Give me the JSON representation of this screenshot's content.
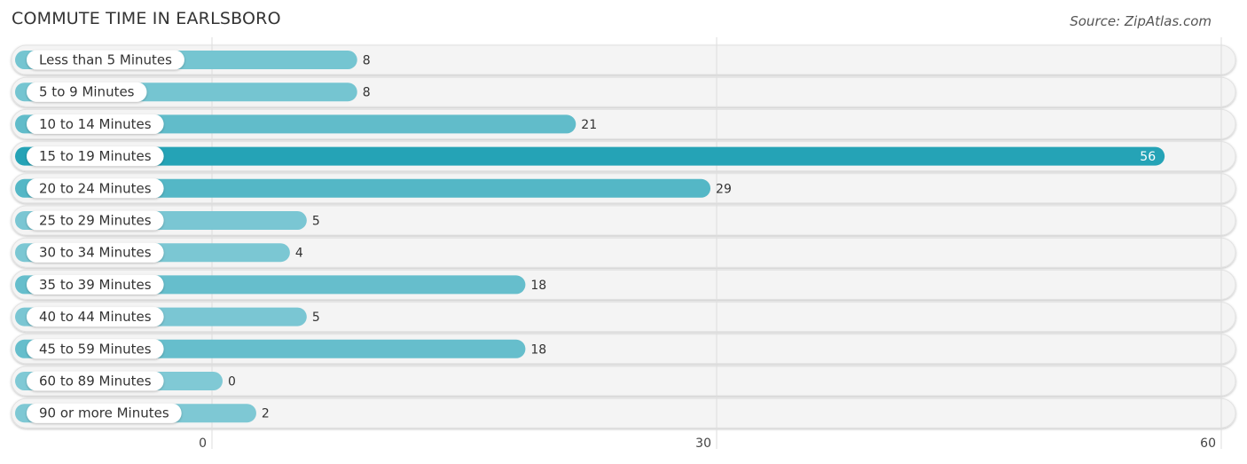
{
  "header": {
    "title": "COMMUTE TIME IN EARLSBORO",
    "source": "Source: ZipAtlas.com"
  },
  "colors": {
    "bar_low": "#80c9d5",
    "bar_high": "#25a3b6",
    "track": "#f4f4f4",
    "grid": "#dddddd"
  },
  "chart_data": {
    "type": "bar",
    "orientation": "horizontal",
    "title": "COMMUTE TIME IN EARLSBORO",
    "xlabel": "",
    "ylabel": "",
    "xlim": [
      0,
      60
    ],
    "xticks": [
      0,
      30,
      60
    ],
    "grid": true,
    "categories": [
      "Less than 5 Minutes",
      "5 to 9 Minutes",
      "10 to 14 Minutes",
      "15 to 19 Minutes",
      "20 to 24 Minutes",
      "25 to 29 Minutes",
      "30 to 34 Minutes",
      "35 to 39 Minutes",
      "40 to 44 Minutes",
      "45 to 59 Minutes",
      "60 to 89 Minutes",
      "90 or more Minutes"
    ],
    "values": [
      8,
      8,
      21,
      56,
      29,
      5,
      4,
      18,
      5,
      18,
      0,
      2
    ]
  }
}
